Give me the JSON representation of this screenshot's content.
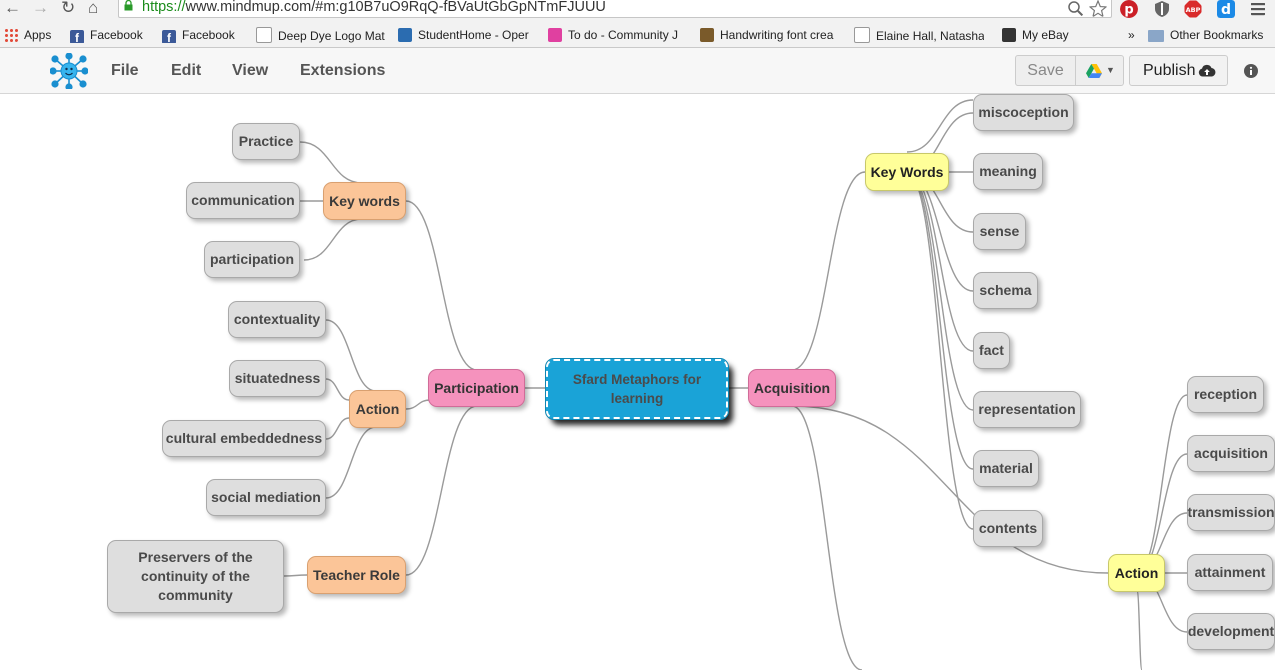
{
  "browser": {
    "url_protocol": "https://",
    "url_rest": "www.mindmup.com/#m:g10B7uO9RqQ-fBVaUtGbGpNTmFJUUU",
    "bookmarks": [
      {
        "label": "Apps",
        "icon": "apps-grid-icon",
        "color": "#e24c3b"
      },
      {
        "label": "Facebook",
        "icon": "facebook-icon",
        "color": "#3b5998"
      },
      {
        "label": "Facebook",
        "icon": "facebook-icon",
        "color": "#3b5998"
      },
      {
        "label": "Deep Dye Logo Mat",
        "icon": "page-icon",
        "color": "#ffffff"
      },
      {
        "label": "StudentHome - Oper",
        "icon": "shield-icon",
        "color": "#2b6cb0"
      },
      {
        "label": "To do - Community J",
        "icon": "music-icon",
        "color": "#e040a0"
      },
      {
        "label": "Handwriting font crea",
        "icon": "bug-icon",
        "color": "#7a5a2a"
      },
      {
        "label": "Elaine Hall, Natasha",
        "icon": "page-icon",
        "color": "#ffffff"
      },
      {
        "label": "My eBay",
        "icon": "ebay-icon",
        "color": "#333333"
      },
      {
        "label": "»",
        "icon": "",
        "color": ""
      },
      {
        "label": "Other Bookmarks",
        "icon": "folder-icon",
        "color": "#8aa6c8"
      }
    ],
    "extensions": [
      "zoom-icon",
      "star-icon",
      "pinterest-icon",
      "shield-icon",
      "adblock-icon",
      "d-icon",
      "menu-icon"
    ]
  },
  "app": {
    "logo": "mindmup-logo-icon",
    "menus": [
      "File",
      "Edit",
      "View",
      "Extensions"
    ],
    "save_label": "Save",
    "publish_label": "Publish"
  },
  "map": {
    "root": "Sfard Metaphors for learning",
    "left": {
      "label": "Participation",
      "groups": [
        {
          "label": "Key words",
          "children": [
            "Practice",
            "communication",
            "participation"
          ]
        },
        {
          "label": "Action",
          "children": [
            "contextuality",
            "situatedness",
            "cultural embeddedness",
            "social mediation"
          ]
        },
        {
          "label": "Teacher Role",
          "children": [
            "Preservers of the continuity of the community"
          ]
        }
      ]
    },
    "right": {
      "label": "Acquisition",
      "groups": [
        {
          "label": "Key Words",
          "children": [
            "miscoception",
            "meaning",
            "sense",
            "schema",
            "fact",
            "representation",
            "material",
            "contents"
          ]
        },
        {
          "label": "Action",
          "children": [
            "reception",
            "acquisition",
            "transmission",
            "attainment",
            "development"
          ]
        }
      ]
    },
    "colors": {
      "root": "#1aa3d7",
      "level1": "#f592bd",
      "left_level2": "#fbc598",
      "right_level2": "#ffff99",
      "leaf": "#dedede",
      "connector": "#9a9a9a"
    }
  }
}
